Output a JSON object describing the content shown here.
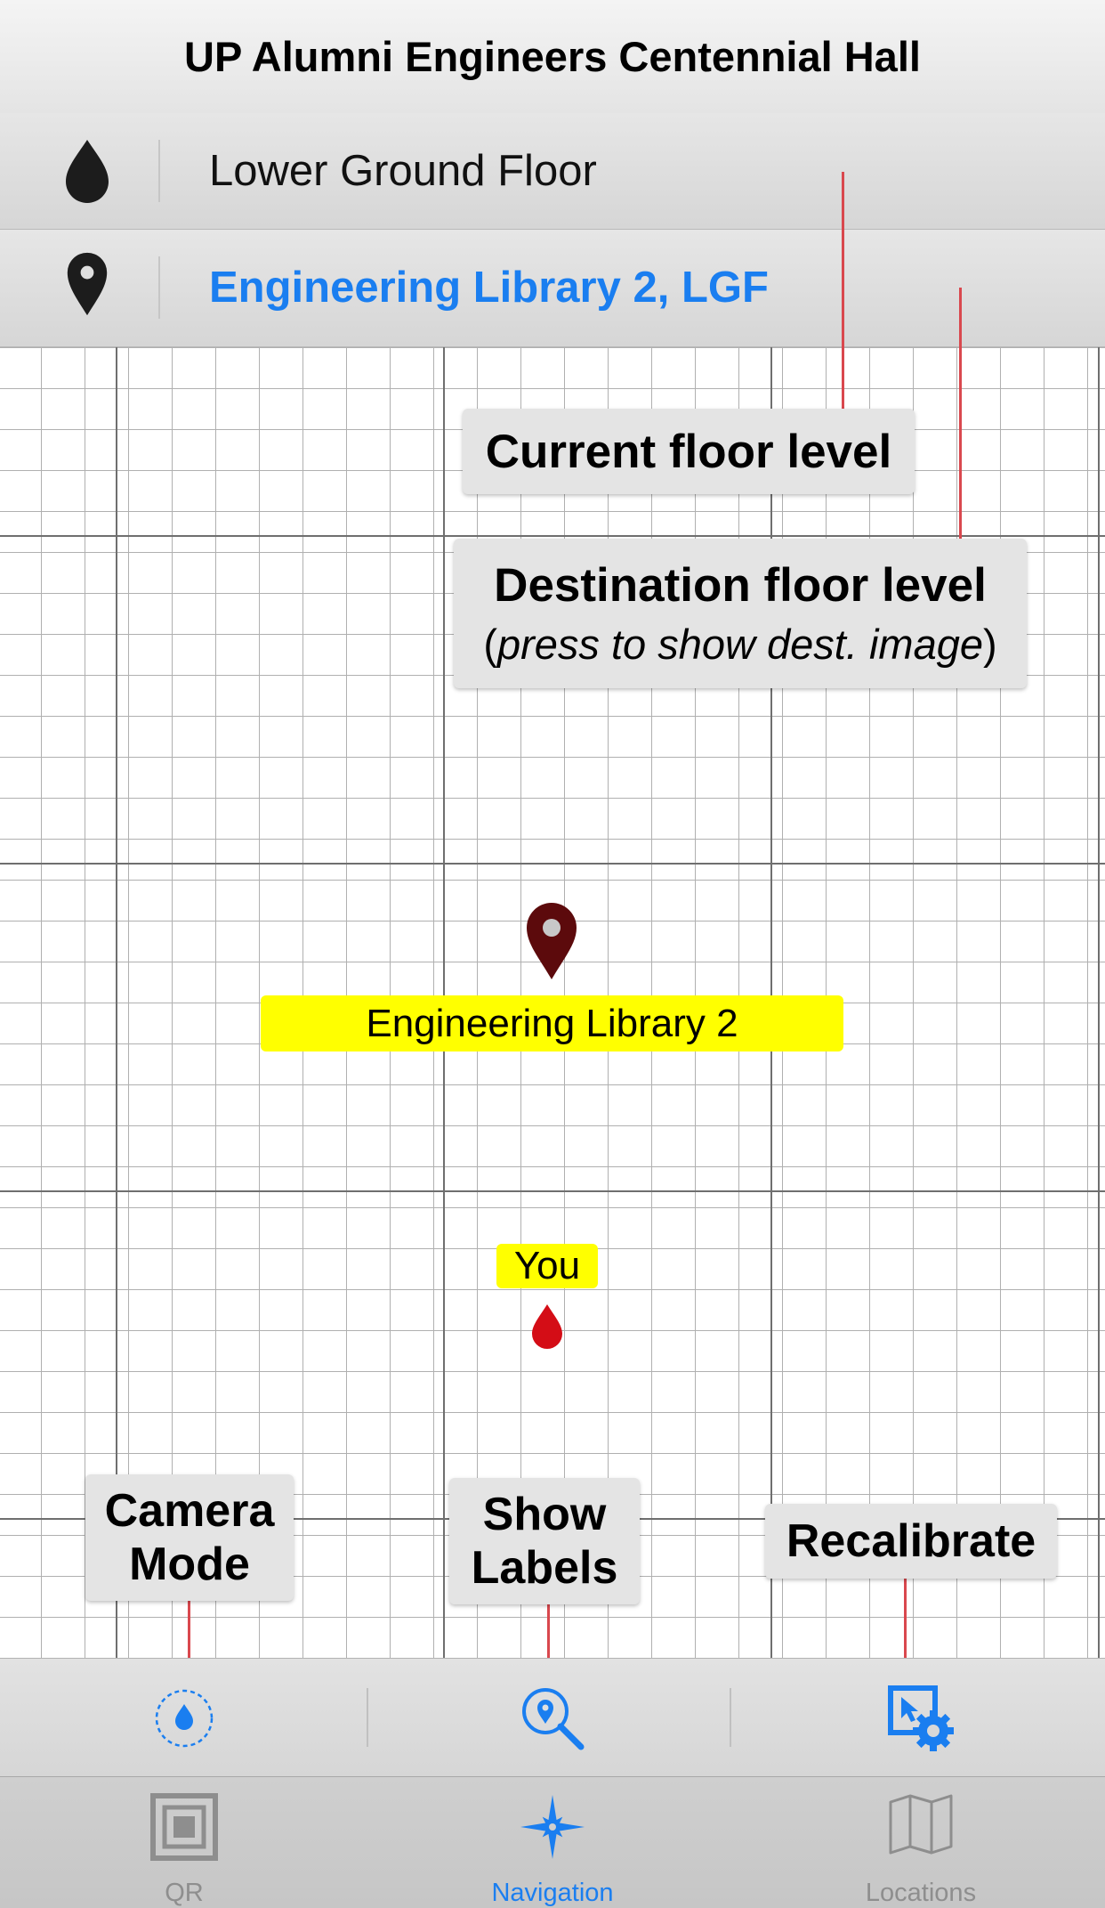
{
  "header": {
    "title": "UP Alumni Engineers Centennial Hall"
  },
  "floor_info": {
    "current_floor": "Lower Ground Floor",
    "destination": "Engineering Library 2, LGF"
  },
  "callouts": {
    "current_floor": "Current floor level",
    "destination_title": "Destination floor level",
    "destination_hint_open": "(",
    "destination_hint_italic": "press to show dest. image",
    "destination_hint_close": ")",
    "camera_line1": "Camera",
    "camera_line2": "Mode",
    "labels_line1": "Show",
    "labels_line2": "Labels",
    "recalibrate": "Recalibrate"
  },
  "map": {
    "destination_label": "Engineering Library 2",
    "user_label": "You"
  },
  "toolbar": {
    "buttons": [
      {
        "icon": "location-drop-circle-icon"
      },
      {
        "icon": "search-location-icon"
      },
      {
        "icon": "recalibrate-gear-icon"
      }
    ]
  },
  "tabs": [
    {
      "label": "QR",
      "icon": "qr-icon",
      "active": false
    },
    {
      "label": "Navigation",
      "icon": "compass-star-icon",
      "active": true
    },
    {
      "label": "Locations",
      "icon": "map-icon",
      "active": false
    }
  ],
  "colors": {
    "accent": "#1a7ef0",
    "highlight": "#ffff00",
    "annotation_line": "#d9484e",
    "destination_pin": "#5c0a0c",
    "user_marker": "#d40d16",
    "inactive_tab": "#8e8e8e"
  }
}
